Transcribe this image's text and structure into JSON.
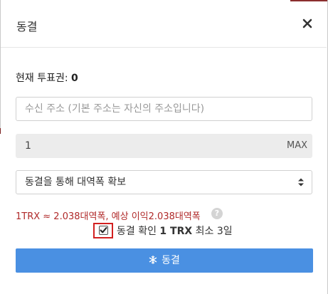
{
  "modal": {
    "title": "동결",
    "close_icon": "close-icon"
  },
  "ballot": {
    "label": "현재 투표권: ",
    "count": "0"
  },
  "address": {
    "placeholder": "수신 주소 (기본 주소는 자신의 주소입니다)"
  },
  "amount": {
    "value": "1",
    "max_label": "MAX"
  },
  "resource_select": {
    "selected": "동결을 통해 대역폭 확보",
    "arrow_icon": "select-arrows-icon"
  },
  "rate": {
    "text": "1TRX ≈ 2.038대역폭, 예상 이익2.038대역폭",
    "help_label": "?"
  },
  "confirm": {
    "checked": true,
    "prefix": "동결 확인 ",
    "amount": "1 TRX",
    "suffix": " 최소 3일"
  },
  "freeze_button": {
    "label": "동결",
    "icon": "snowflake-icon"
  },
  "colors": {
    "primary_button": "#4a90e2",
    "rate_text": "#b02a2a",
    "highlight_box": "#d22020"
  }
}
